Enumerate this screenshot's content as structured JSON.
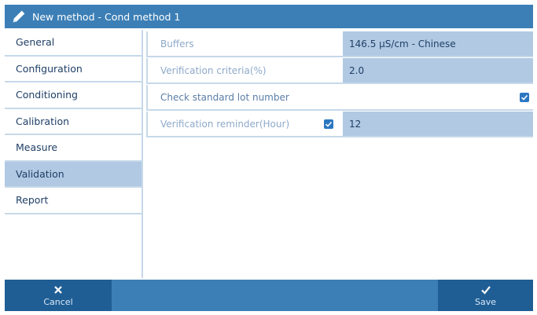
{
  "window": {
    "title": "New method - Cond method 1",
    "icon": "pencil-icon"
  },
  "sidebar": {
    "items": [
      {
        "label": "General",
        "active": false
      },
      {
        "label": "Configuration",
        "active": false
      },
      {
        "label": "Conditioning",
        "active": false
      },
      {
        "label": "Calibration",
        "active": false
      },
      {
        "label": "Measure",
        "active": false
      },
      {
        "label": "Validation",
        "active": true
      },
      {
        "label": "Report",
        "active": false
      }
    ]
  },
  "validation": {
    "buffers_label": "Buffers",
    "buffers_value": "146.5 µS/cm - Chinese",
    "criteria_label": "Verification criteria(%)",
    "criteria_value": "2.0",
    "lot_label": "Check standard lot number",
    "lot_checked": true,
    "reminder_label": "Verification reminder(Hour)",
    "reminder_checked": true,
    "reminder_value": "12"
  },
  "footer": {
    "cancel_label": "Cancel",
    "cancel_icon": "close-icon",
    "save_label": "Save",
    "save_icon": "check-icon"
  },
  "colors": {
    "accent": "#3c7fb6",
    "accent_dark": "#1f5e95",
    "selection": "#b1c9e3",
    "checkbox": "#2b77c1"
  }
}
